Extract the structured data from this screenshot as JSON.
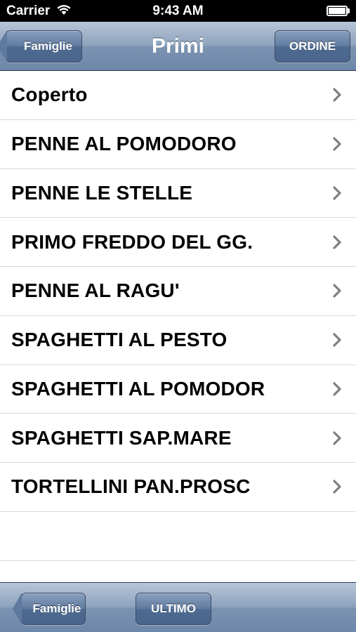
{
  "status_bar": {
    "carrier": "Carrier",
    "time": "9:43 AM"
  },
  "nav_bar": {
    "title": "Primi",
    "back_label": "Famiglie",
    "right_label": "ORDINE"
  },
  "items": [
    {
      "label": "Coperto"
    },
    {
      "label": "PENNE AL POMODORO"
    },
    {
      "label": "PENNE LE STELLE"
    },
    {
      "label": "PRIMO FREDDO DEL GG."
    },
    {
      "label": "PENNE AL RAGU'"
    },
    {
      "label": "SPAGHETTI AL PESTO"
    },
    {
      "label": "SPAGHETTI AL POMODOR"
    },
    {
      "label": "SPAGHETTI SAP.MARE"
    },
    {
      "label": "TORTELLINI PAN.PROSC"
    }
  ],
  "toolbar": {
    "back_label": "Famiglie",
    "ultimo_label": "ULTIMO"
  },
  "icons": {
    "wifi": "wifi-icon",
    "battery": "battery-icon",
    "row_accessory": "chevron-right-icon"
  },
  "colors": {
    "bar_tint": "#7b93b1",
    "button_tint": "#5f7a9e",
    "separator": "#d9d9d9",
    "chevron": "#7f7f7f"
  }
}
